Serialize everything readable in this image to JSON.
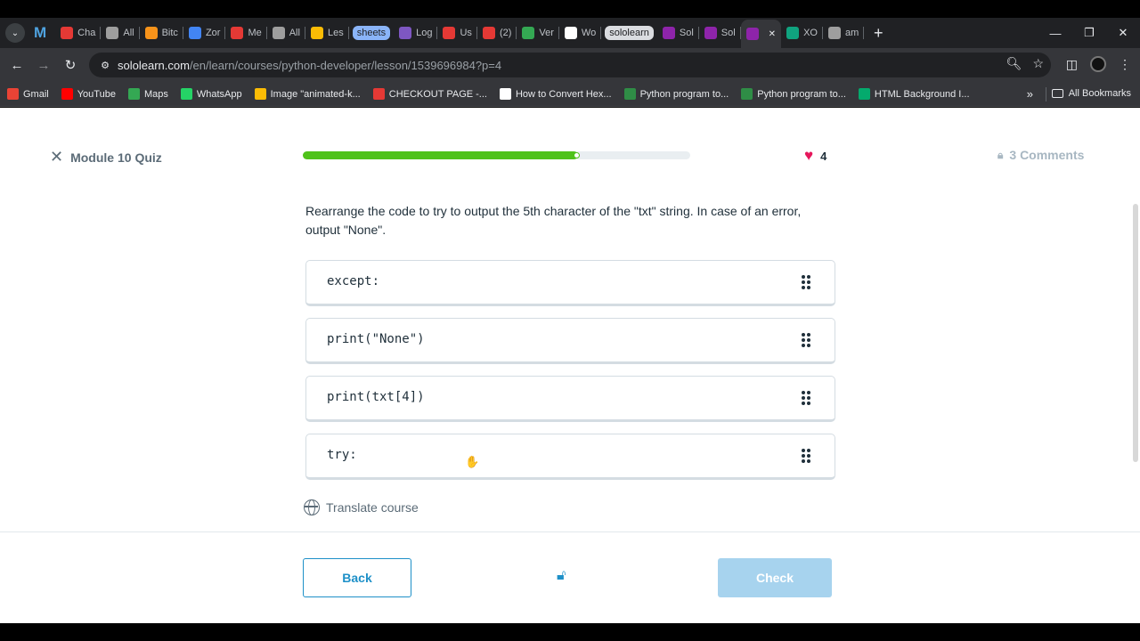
{
  "browser": {
    "tabs": [
      {
        "label": "Cha",
        "icon": "chatgpt-icon",
        "color": "#e53935"
      },
      {
        "label": "All",
        "icon": "openai-icon",
        "color": "#9e9e9e"
      },
      {
        "label": "Bitc",
        "icon": "bitcoin-icon",
        "color": "#f7931a"
      },
      {
        "label": "Zor",
        "icon": "zoro-icon",
        "color": "#4285f4"
      },
      {
        "label": "Me",
        "icon": "mega-icon",
        "color": "#e53935"
      },
      {
        "label": "All",
        "icon": "openai-icon",
        "color": "#9e9e9e"
      },
      {
        "label": "Les",
        "icon": "map-pin-icon",
        "color": "#fbbc05"
      },
      {
        "label": "sheets",
        "pill": true,
        "grey": false
      },
      {
        "label": "Log",
        "icon": "login-icon",
        "color": "#7e57c2"
      },
      {
        "label": "Us",
        "icon": "mail-icon",
        "color": "#e53935"
      },
      {
        "label": "(2)",
        "icon": "messenger-icon",
        "color": "#e53935"
      },
      {
        "label": "Ver",
        "icon": "drive-icon",
        "color": "#34a853"
      },
      {
        "label": "Wo",
        "icon": "amazon-icon",
        "color": "#ffffff"
      },
      {
        "label": "sololearn",
        "pill": true,
        "grey": true
      },
      {
        "label": "Sol",
        "icon": "sololearn-icon",
        "color": "#8e24aa"
      },
      {
        "label": "Sol",
        "icon": "sololearn-icon",
        "color": "#8e24aa"
      },
      {
        "label": "",
        "icon": "sololearn-icon",
        "color": "#8e24aa",
        "active": true
      },
      {
        "label": "XO",
        "icon": "openai-icon",
        "color": "#10a37f"
      },
      {
        "label": "am",
        "icon": "openai-icon",
        "color": "#9e9e9e"
      }
    ],
    "url_host": "sololearn.com",
    "url_path": "/en/learn/courses/python-developer/lesson/1539696984?p=4",
    "bookmarks": [
      {
        "label": "Gmail",
        "icon": "gmail-icon",
        "color": "#ea4335"
      },
      {
        "label": "YouTube",
        "icon": "youtube-icon",
        "color": "#ff0000"
      },
      {
        "label": "Maps",
        "icon": "maps-icon",
        "color": "#34a853"
      },
      {
        "label": "WhatsApp",
        "icon": "whatsapp-icon",
        "color": "#25d366"
      },
      {
        "label": "Image \"animated-k...",
        "icon": "star-icon",
        "color": "#fbbc05"
      },
      {
        "label": "CHECKOUT PAGE -...",
        "icon": "checkout-icon",
        "color": "#e53935"
      },
      {
        "label": "How to Convert Hex...",
        "icon": "alpha-icon",
        "color": "#ffffff"
      },
      {
        "label": "Python program to...",
        "icon": "gfg-icon",
        "color": "#2f8d46"
      },
      {
        "label": "Python program to...",
        "icon": "gfg-icon",
        "color": "#2f8d46"
      },
      {
        "label": "HTML Background I...",
        "icon": "w3-icon",
        "color": "#04aa6d"
      }
    ],
    "all_bookmarks": "All Bookmarks"
  },
  "lesson": {
    "title": "Module 10 Quiz",
    "progress_fraction": 0.71,
    "hearts": "4",
    "comments": "3 Comments",
    "question": "Rearrange the code to try to output the 5th character of the \"txt\" string. In case of an error, output \"None\".",
    "blocks": [
      "except:",
      "print(\"None\")",
      "print(txt[4])",
      "try:"
    ],
    "translate": "Translate course",
    "back_label": "Back",
    "check_label": "Check",
    "accent": "#1e90c8",
    "progress_color": "#4fc21a",
    "heart_color": "#e6175c"
  }
}
